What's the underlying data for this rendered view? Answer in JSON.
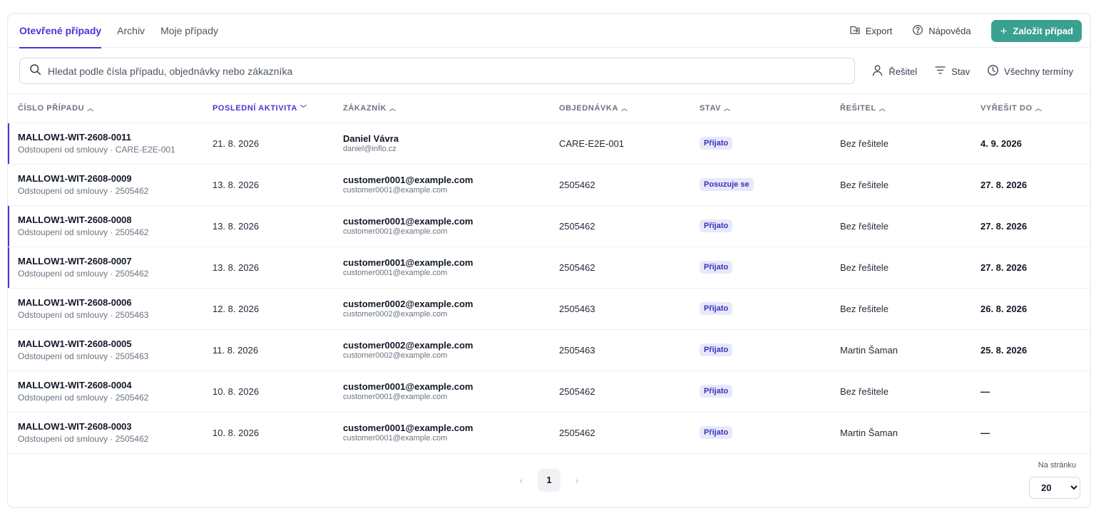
{
  "tabs": [
    {
      "label": "Otevřené případy",
      "active": true
    },
    {
      "label": "Archiv",
      "active": false
    },
    {
      "label": "Moje případy",
      "active": false
    }
  ],
  "actions": {
    "export_label": "Export",
    "help_label": "Nápověda",
    "create_label": "Založit případ"
  },
  "search": {
    "placeholder": "Hledat podle čísla případu, objednávky nebo zákazníka",
    "value": ""
  },
  "filters": {
    "assignee_label": "Řešitel",
    "status_label": "Stav",
    "deadline_label": "Všechny termíny"
  },
  "columns": [
    {
      "label": "ČÍSLO PŘÍPADU",
      "sorted": false,
      "direction": "asc"
    },
    {
      "label": "POSLEDNÍ AKTIVITA",
      "sorted": true,
      "direction": "desc"
    },
    {
      "label": "ZÁKAZNÍK",
      "sorted": false,
      "direction": "asc"
    },
    {
      "label": "OBJEDNÁVKA",
      "sorted": false,
      "direction": "asc"
    },
    {
      "label": "STAV",
      "sorted": false,
      "direction": "asc"
    },
    {
      "label": "ŘEŠITEL",
      "sorted": false,
      "direction": "asc"
    },
    {
      "label": "VYŘEŠIT DO",
      "sorted": false,
      "direction": "asc"
    }
  ],
  "rows": [
    {
      "case_id": "MALLOW1-WIT-2608-0011",
      "case_sub": "Odstoupení od smlouvy · CARE-E2E-001",
      "activity": "21. 8. 2026",
      "customer_name": "Daniel Vávra",
      "customer_email": "daniel@inflo.cz",
      "order": "CARE-E2E-001",
      "status": "Přijato",
      "assignee": "Bez řešitele",
      "deadline": "4. 9. 2026",
      "marked": true
    },
    {
      "case_id": "MALLOW1-WIT-2608-0009",
      "case_sub": "Odstoupení od smlouvy · 2505462",
      "activity": "13. 8. 2026",
      "customer_name": "customer0001@example.com",
      "customer_email": "customer0001@example.com",
      "order": "2505462",
      "status": "Posuzuje se",
      "assignee": "Bez řešitele",
      "deadline": "27. 8. 2026",
      "marked": false
    },
    {
      "case_id": "MALLOW1-WIT-2608-0008",
      "case_sub": "Odstoupení od smlouvy · 2505462",
      "activity": "13. 8. 2026",
      "customer_name": "customer0001@example.com",
      "customer_email": "customer0001@example.com",
      "order": "2505462",
      "status": "Přijato",
      "assignee": "Bez řešitele",
      "deadline": "27. 8. 2026",
      "marked": true
    },
    {
      "case_id": "MALLOW1-WIT-2608-0007",
      "case_sub": "Odstoupení od smlouvy · 2505462",
      "activity": "13. 8. 2026",
      "customer_name": "customer0001@example.com",
      "customer_email": "customer0001@example.com",
      "order": "2505462",
      "status": "Přijato",
      "assignee": "Bez řešitele",
      "deadline": "27. 8. 2026",
      "marked": true
    },
    {
      "case_id": "MALLOW1-WIT-2608-0006",
      "case_sub": "Odstoupení od smlouvy · 2505463",
      "activity": "12. 8. 2026",
      "customer_name": "customer0002@example.com",
      "customer_email": "customer0002@example.com",
      "order": "2505463",
      "status": "Přijato",
      "assignee": "Bez řešitele",
      "deadline": "26. 8. 2026",
      "marked": false
    },
    {
      "case_id": "MALLOW1-WIT-2608-0005",
      "case_sub": "Odstoupení od smlouvy · 2505463",
      "activity": "11. 8. 2026",
      "customer_name": "customer0002@example.com",
      "customer_email": "customer0002@example.com",
      "order": "2505463",
      "status": "Přijato",
      "assignee": "Martin Šaman",
      "deadline": "25. 8. 2026",
      "marked": false
    },
    {
      "case_id": "MALLOW1-WIT-2608-0004",
      "case_sub": "Odstoupení od smlouvy · 2505462",
      "activity": "10. 8. 2026",
      "customer_name": "customer0001@example.com",
      "customer_email": "customer0001@example.com",
      "order": "2505462",
      "status": "Přijato",
      "assignee": "Bez řešitele",
      "deadline": "—",
      "marked": false
    },
    {
      "case_id": "MALLOW1-WIT-2608-0003",
      "case_sub": "Odstoupení od smlouvy · 2505462",
      "activity": "10. 8. 2026",
      "customer_name": "customer0001@example.com",
      "customer_email": "customer0001@example.com",
      "order": "2505462",
      "status": "Přijato",
      "assignee": "Martin Šaman",
      "deadline": "—",
      "marked": false
    }
  ],
  "pagination": {
    "current_page": "1",
    "per_page_label": "Na stránku",
    "per_page_value": "20"
  },
  "colors": {
    "accent": "#4f32d8",
    "primary_button": "#3aa191",
    "badge_bg": "#e7e9fb",
    "badge_text": "#3b30b8"
  }
}
